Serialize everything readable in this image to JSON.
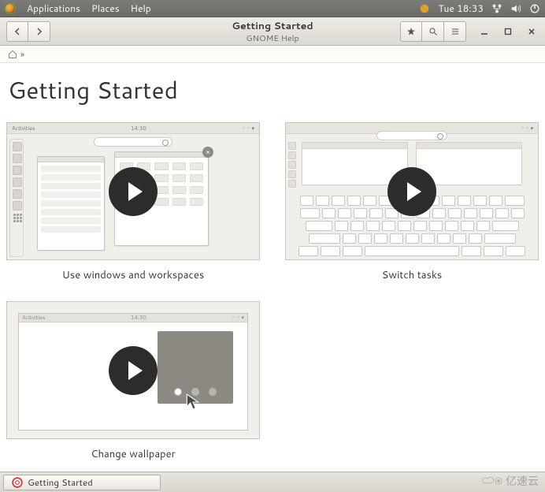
{
  "system_panel": {
    "menus": [
      "Applications",
      "Places",
      "Help"
    ],
    "clock": "Tue 18:33"
  },
  "window": {
    "title": "Getting Started",
    "subtitle": "GNOME Help",
    "breadcrumb_sep": "»"
  },
  "page": {
    "heading": "Getting Started",
    "cards": [
      {
        "caption": "Use windows and workspaces",
        "mock_activities": "Activities",
        "mock_time": "14:30"
      },
      {
        "caption": "Switch tasks"
      },
      {
        "caption": "Change wallpaper",
        "mock_activities": "Activities",
        "mock_time": "14:30"
      }
    ]
  },
  "taskbar": {
    "active_task": "Getting Started"
  },
  "watermark": "亿速云"
}
